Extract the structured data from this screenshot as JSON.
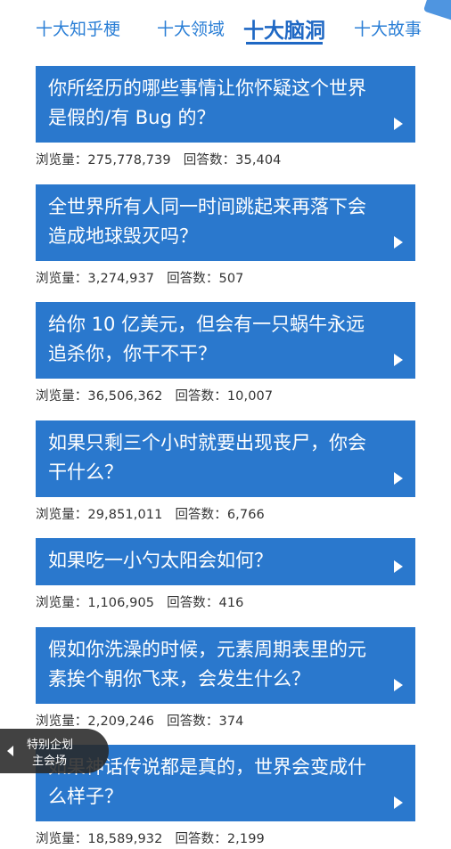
{
  "tabs": [
    {
      "label": "十大知乎梗",
      "active": false
    },
    {
      "label": "十大领域",
      "active": false
    },
    {
      "label": "十大脑洞",
      "active": true
    },
    {
      "label": "十大故事",
      "active": false
    }
  ],
  "labels": {
    "views": "浏览量：",
    "answers": "回答数："
  },
  "items": [
    {
      "title": "你所经历的哪些事情让你怀疑这个世界是假的/有 Bug 的？",
      "views": "275,778,739",
      "answers": "35,404"
    },
    {
      "title": "全世界所有人同一时间跳起来再落下会造成地球毁灭吗？",
      "views": "3,274,937",
      "answers": "507"
    },
    {
      "title": "给你 10 亿美元，但会有一只蜗牛永远追杀你，你干不干？",
      "views": "36,506,362",
      "answers": "10,007"
    },
    {
      "title": "如果只剩三个小时就要出现丧尸，你会干什么？",
      "views": "29,851,011",
      "answers": "6,766"
    },
    {
      "title": "如果吃一小勺太阳会如何？",
      "views": "1,106,905",
      "answers": "416"
    },
    {
      "title": "假如你洗澡的时候，元素周期表里的元素挨个朝你飞来，会发生什么？",
      "views": "2,209,246",
      "answers": "374"
    },
    {
      "title": "如果神话传说都是真的，世界会变成什么样子？",
      "views": "18,589,932",
      "answers": "2,199"
    }
  ],
  "floating_tab": {
    "line1": "特别企划",
    "line2": "主会场"
  },
  "colors": {
    "card_bg": "#2a78cd",
    "tab_text": "#2b7fd6",
    "tab_active": "#1f68c4"
  }
}
